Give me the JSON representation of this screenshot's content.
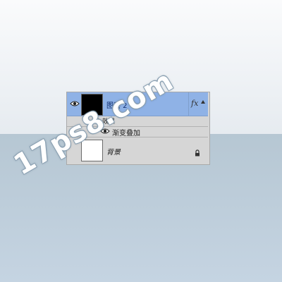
{
  "layers_panel": {
    "layers": [
      {
        "name": "图层 2",
        "fx": "fx",
        "selected": true
      },
      {
        "name": "效果",
        "type": "effects-group"
      },
      {
        "name": "渐变叠加",
        "type": "effect"
      },
      {
        "name": "背景",
        "locked": true
      }
    ]
  },
  "watermark": {
    "text": "17ps8.com"
  },
  "colors": {
    "selected_row": "#8fb2e6",
    "panel": "#d6d6d6",
    "canvas_top": "#e6ebf0",
    "canvas_bottom": "#b6c7d3"
  }
}
